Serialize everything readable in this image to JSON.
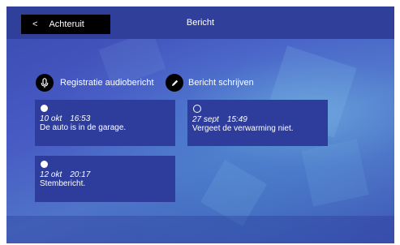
{
  "header": {
    "back_label": "Achteruit",
    "back_icon": "<",
    "title": "Bericht"
  },
  "actions": {
    "record_label": "Registratie audiobericht",
    "write_label": "Bericht schrijven"
  },
  "messages": [
    {
      "date": "10 okt",
      "time": "16:53",
      "text": "De auto is in de garage.",
      "status": "read"
    },
    {
      "date": "27 sept",
      "time": "15:49",
      "text": "Vergeet de verwarming niet.",
      "status": "unread"
    },
    {
      "date": "12 okt",
      "time": "20:17",
      "text": "Stembericht.",
      "status": "read"
    }
  ],
  "colors": {
    "topbar": "#2f3f9a",
    "card": "#2e3d9c",
    "button": "#000000"
  }
}
